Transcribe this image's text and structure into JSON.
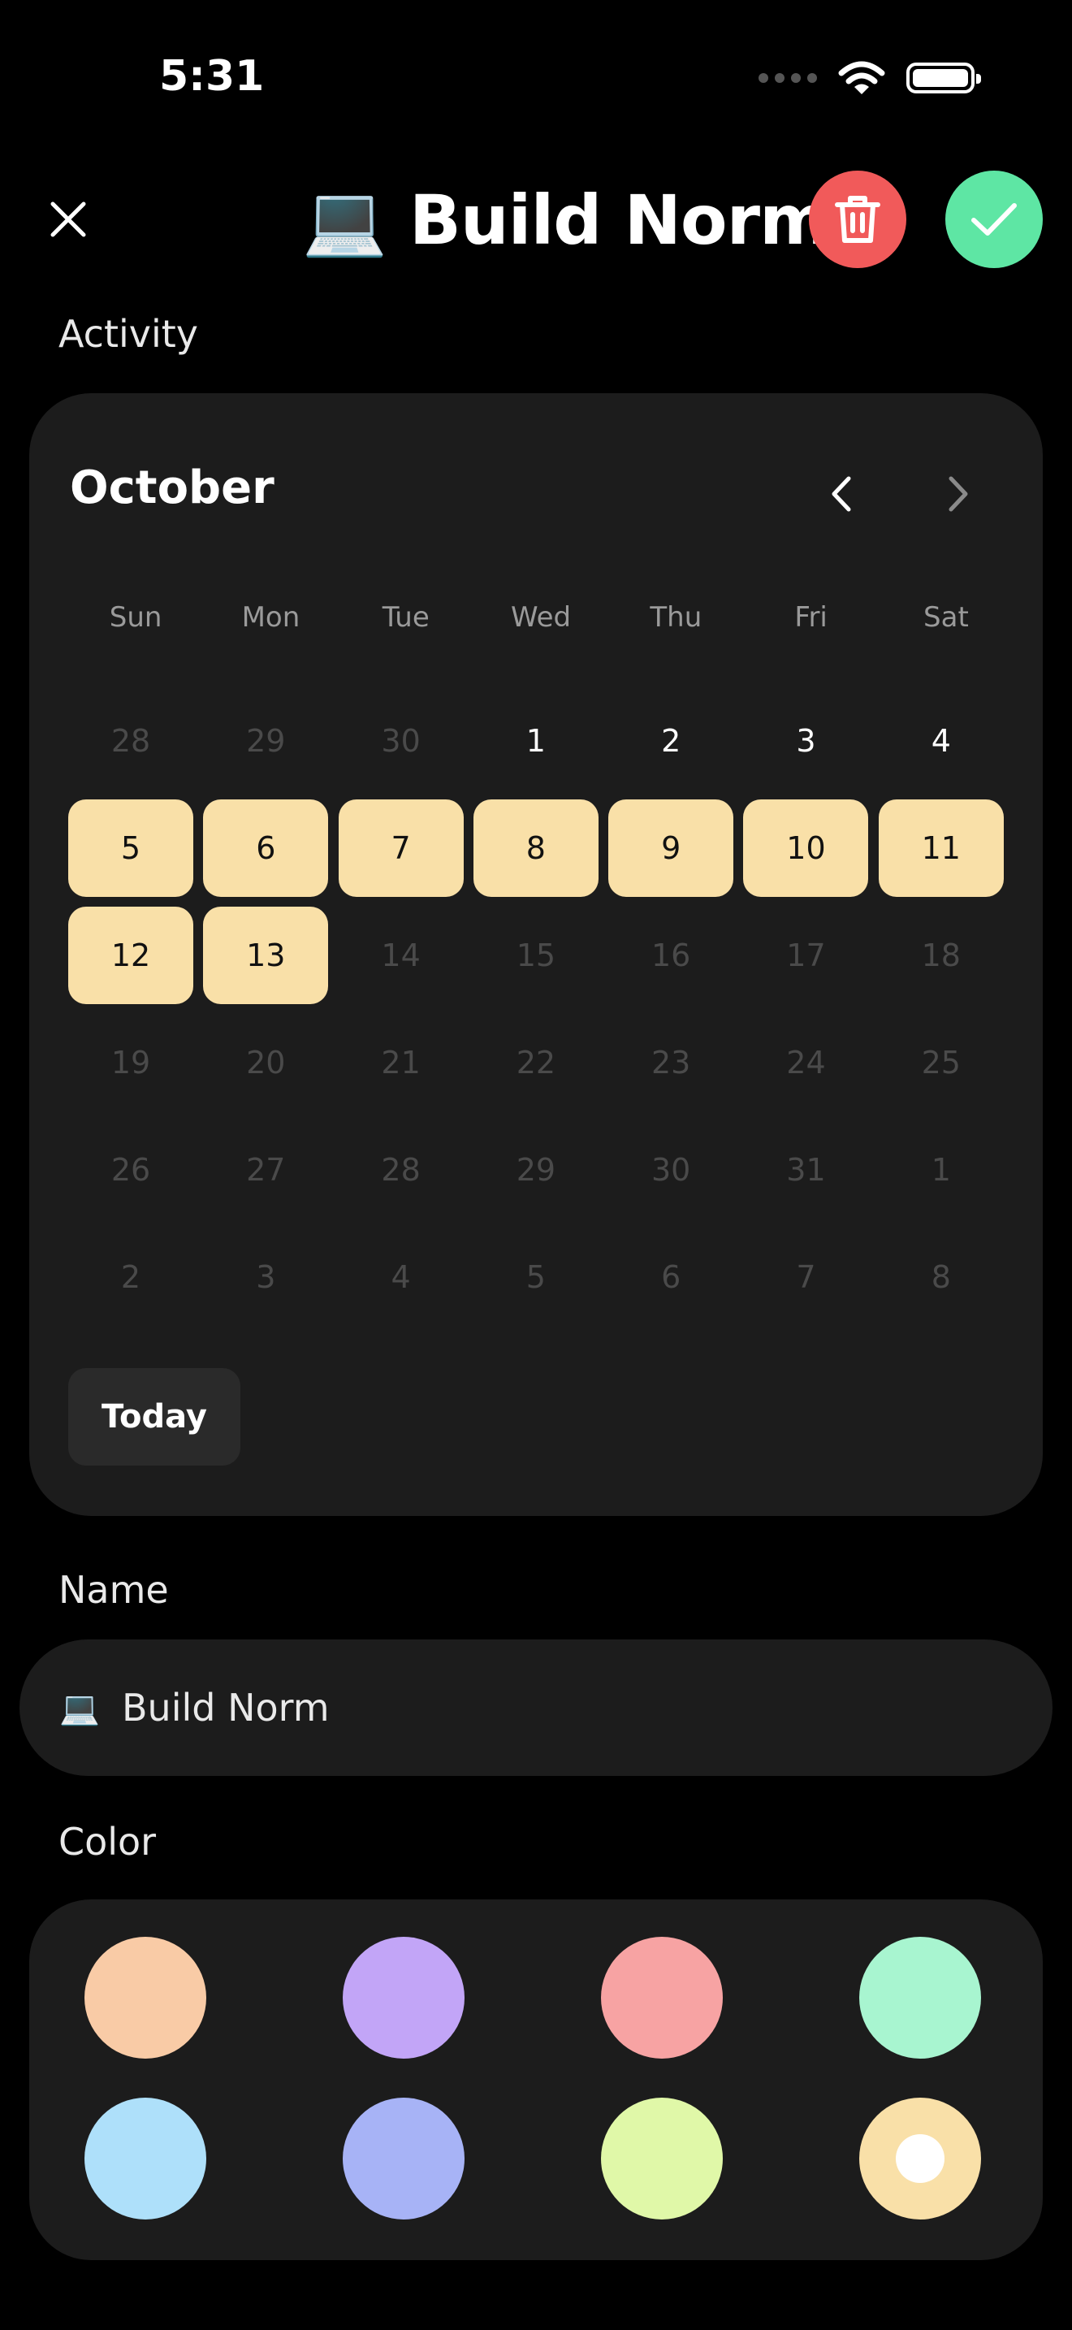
{
  "status_bar": {
    "time": "5:31"
  },
  "header": {
    "emoji": "💻",
    "title": "Build Norm"
  },
  "activity": {
    "label": "Activity",
    "month": "October",
    "weekdays": [
      "Sun",
      "Mon",
      "Tue",
      "Wed",
      "Thu",
      "Fri",
      "Sat"
    ],
    "days": [
      {
        "d": "28",
        "s": "dim"
      },
      {
        "d": "29",
        "s": "dim"
      },
      {
        "d": "30",
        "s": "dim"
      },
      {
        "d": "1",
        "s": "cur"
      },
      {
        "d": "2",
        "s": "cur"
      },
      {
        "d": "3",
        "s": "cur"
      },
      {
        "d": "4",
        "s": "cur"
      },
      {
        "d": "5",
        "s": "sel"
      },
      {
        "d": "6",
        "s": "sel"
      },
      {
        "d": "7",
        "s": "sel"
      },
      {
        "d": "8",
        "s": "sel"
      },
      {
        "d": "9",
        "s": "sel"
      },
      {
        "d": "10",
        "s": "sel"
      },
      {
        "d": "11",
        "s": "sel"
      },
      {
        "d": "12",
        "s": "sel"
      },
      {
        "d": "13",
        "s": "sel"
      },
      {
        "d": "14",
        "s": "dim"
      },
      {
        "d": "15",
        "s": "dim"
      },
      {
        "d": "16",
        "s": "dim"
      },
      {
        "d": "17",
        "s": "dim"
      },
      {
        "d": "18",
        "s": "dim"
      },
      {
        "d": "19",
        "s": "dim"
      },
      {
        "d": "20",
        "s": "dim"
      },
      {
        "d": "21",
        "s": "dim"
      },
      {
        "d": "22",
        "s": "dim"
      },
      {
        "d": "23",
        "s": "dim"
      },
      {
        "d": "24",
        "s": "dim"
      },
      {
        "d": "25",
        "s": "dim"
      },
      {
        "d": "26",
        "s": "dim"
      },
      {
        "d": "27",
        "s": "dim"
      },
      {
        "d": "28",
        "s": "dim"
      },
      {
        "d": "29",
        "s": "dim"
      },
      {
        "d": "30",
        "s": "dim"
      },
      {
        "d": "31",
        "s": "dim"
      },
      {
        "d": "1",
        "s": "dim"
      },
      {
        "d": "2",
        "s": "dim"
      },
      {
        "d": "3",
        "s": "dim"
      },
      {
        "d": "4",
        "s": "dim"
      },
      {
        "d": "5",
        "s": "dim"
      },
      {
        "d": "6",
        "s": "dim"
      },
      {
        "d": "7",
        "s": "dim"
      },
      {
        "d": "8",
        "s": "dim"
      }
    ],
    "today_label": "Today"
  },
  "name": {
    "label": "Name",
    "value": "Build Norm"
  },
  "color": {
    "label": "Color",
    "swatches": [
      "#f9cba6",
      "#c2a5f7",
      "#f7a3a3",
      "#a8f5d0",
      "#aee0fa",
      "#a7b3f6",
      "#e0f8a8",
      "#f9e0a8"
    ],
    "selected_index": 7
  },
  "colors": {
    "delete": "#f15a5a",
    "confirm": "#5ee6a4",
    "card": "#1c1c1c",
    "selected_day": "#f9e0a8"
  }
}
